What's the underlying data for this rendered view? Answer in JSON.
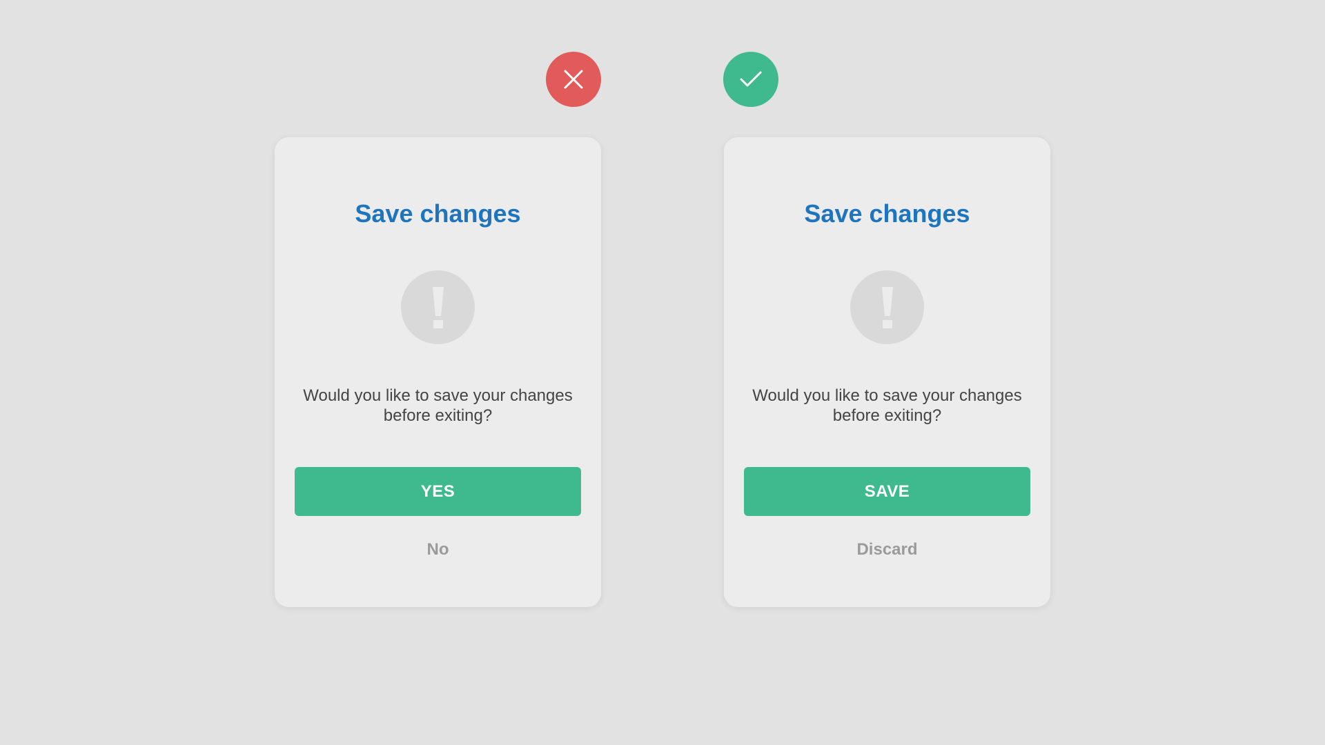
{
  "badges": {
    "bad": {
      "icon": "close-icon",
      "color": "#e15b5b"
    },
    "good": {
      "icon": "check-icon",
      "color": "#3fb98e"
    }
  },
  "dialogs": [
    {
      "title": "Save changes",
      "alert_icon": "exclamation-icon",
      "message": "Would you like to save your changes before exiting?",
      "primary_label": "YES",
      "secondary_label": "No"
    },
    {
      "title": "Save changes",
      "alert_icon": "exclamation-icon",
      "message": "Would you like to save your changes before exiting?",
      "primary_label": "SAVE",
      "secondary_label": "Discard"
    }
  ],
  "colors": {
    "background": "#e2e2e2",
    "card": "#ececec",
    "title": "#1f75bd",
    "primary": "#3fb98e",
    "danger": "#e15b5b",
    "secondary_text": "#9a9a9a"
  }
}
